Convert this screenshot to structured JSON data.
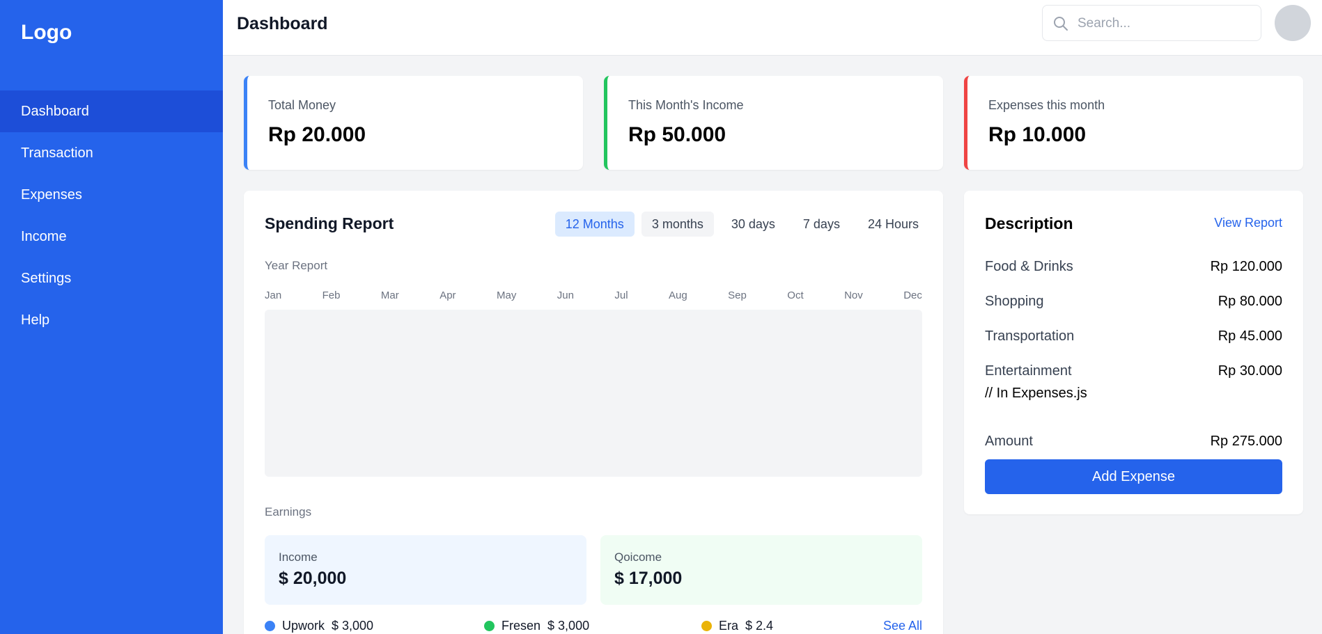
{
  "sidebar": {
    "logo": "Logo",
    "items": [
      {
        "label": "Dashboard"
      },
      {
        "label": "Transaction"
      },
      {
        "label": "Expenses"
      },
      {
        "label": "Income"
      },
      {
        "label": "Settings"
      },
      {
        "label": "Help"
      }
    ],
    "active_index": 0
  },
  "header": {
    "title": "Dashboard",
    "search_placeholder": "Search...",
    "search_icon": "search-icon",
    "avatar_icon": "avatar"
  },
  "stats": [
    {
      "label": "Total Money",
      "value": "Rp 20.000",
      "accent": "#3b82f6"
    },
    {
      "label": "This Month's Income",
      "value": "Rp 50.000",
      "accent": "#22c55e"
    },
    {
      "label": "Expenses this month",
      "value": "Rp 10.000",
      "accent": "#ef4444"
    }
  ],
  "report": {
    "title": "Spending Report",
    "tabs": [
      {
        "label": "12 Months"
      },
      {
        "label": "3 months"
      },
      {
        "label": "30 days"
      },
      {
        "label": "7 days"
      },
      {
        "label": "24 Hours"
      }
    ],
    "active_tab": "12 Months",
    "year_label": "Year Report",
    "months": [
      "Jan",
      "Feb",
      "Mar",
      "Apr",
      "May",
      "Jun",
      "Jul",
      "Aug",
      "Sep",
      "Oct",
      "Nov",
      "Dec"
    ],
    "earnings_label": "Earnings",
    "earnings": [
      {
        "label": "Income",
        "value": "$ 20,000",
        "bg": "#eff6ff"
      },
      {
        "label": "Qoicome",
        "value": "$ 17,000",
        "bg": "#f0fdf4"
      }
    ],
    "sources": [
      {
        "name": "Upwork",
        "amount": "$ 3,000",
        "color": "#3b82f6"
      },
      {
        "name": "Fresen",
        "amount": "$ 3,000",
        "color": "#22c55e"
      },
      {
        "name": "Era",
        "amount": "$ 2.4",
        "color": "#eab308"
      }
    ],
    "see_all": "See All"
  },
  "description": {
    "title": "Description",
    "view_report": "View Report",
    "items": [
      {
        "name": "Food & Drinks",
        "amount": "Rp 120.000"
      },
      {
        "name": "Shopping",
        "amount": "Rp 80.000"
      },
      {
        "name": "Transportation",
        "amount": "Rp 45.000"
      },
      {
        "name": "Entertainment",
        "amount": "Rp 30.000"
      }
    ],
    "comment": "// In Expenses.js",
    "amount_label": "Amount",
    "amount_value": "Rp 275.000",
    "add_button": "Add Expense"
  }
}
